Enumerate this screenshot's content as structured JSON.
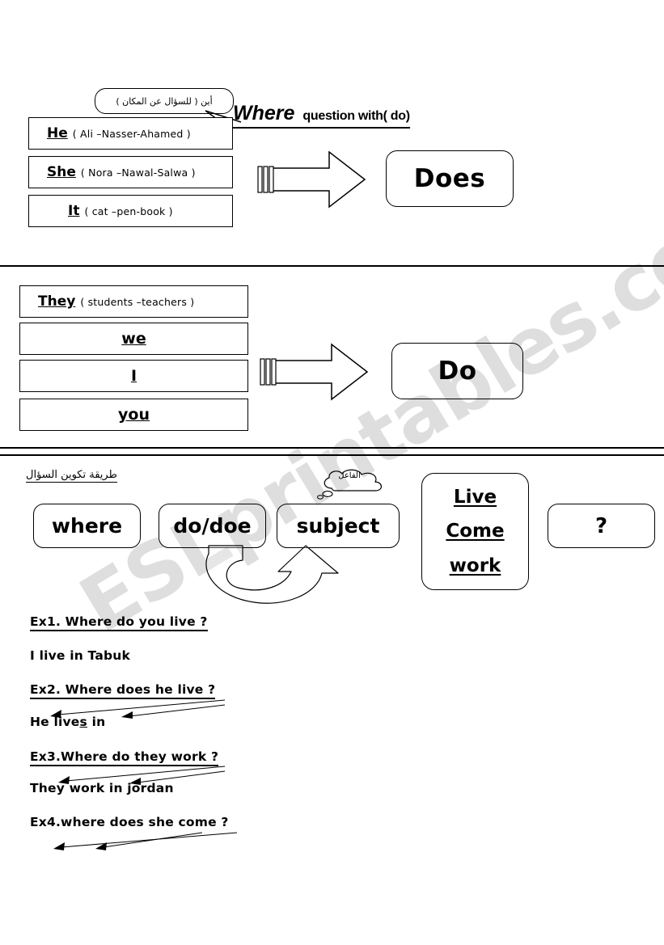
{
  "header": {
    "callout_arabic": "أين ( للسؤال عن المكان )",
    "title_main": "Where",
    "title_rest": "question with( do)"
  },
  "section1": {
    "rows": [
      {
        "pronoun": "He",
        "examples": "( Ali –Nasser-Ahamed )"
      },
      {
        "pronoun": "She",
        "examples": "( Nora –Nawal-Salwa )"
      },
      {
        "pronoun": "It",
        "examples": "( cat –pen-book )"
      }
    ],
    "result": "Does"
  },
  "section2": {
    "rows": [
      {
        "pronoun": "They",
        "examples": "( students –teachers )"
      },
      {
        "pronoun": "we",
        "examples": ""
      },
      {
        "pronoun": "I",
        "examples": ""
      },
      {
        "pronoun": "you",
        "examples": ""
      }
    ],
    "result": "Do"
  },
  "section3": {
    "arabic_heading": "طريقة تكوين السؤال",
    "cloud_arabic": "الفاعل",
    "formula": [
      "where",
      "do/doe",
      "subject"
    ],
    "verbs": [
      "Live",
      "Come",
      "work"
    ],
    "question_mark": "?"
  },
  "examples": [
    {
      "question": "Ex1. Where do you live ?",
      "answer": "I live in Tabuk"
    },
    {
      "question": "Ex2. Where does he live ?",
      "answer": "He lives in"
    },
    {
      "question": "Ex3.Where do they work ?",
      "answer": "They work in jordan"
    },
    {
      "question": "Ex4.where does she come ?",
      "answer": ""
    }
  ],
  "watermark": "ESLprintables.com"
}
